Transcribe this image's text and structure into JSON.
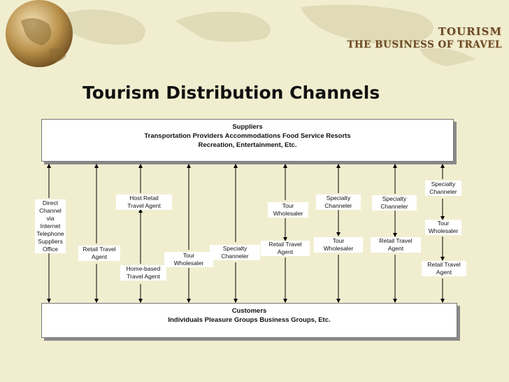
{
  "brand": {
    "line1": "TOURISM",
    "line2": "THE BUSINESS OF TRAVEL"
  },
  "title": "Tourism Distribution Channels",
  "suppliers": {
    "heading": "Suppliers",
    "line1": "Transportation Providers Accommodations Food Service Resorts",
    "line2": "Recreation, Entertainment, Etc."
  },
  "customers": {
    "heading": "Customers",
    "line1": "Individuals Pleasure Groups Business Groups, Etc."
  },
  "channels": {
    "direct": [
      "Direct",
      "Channel",
      "via",
      "Internet",
      "Telephone",
      "Suppliers",
      "Office"
    ],
    "retail_agent_1": [
      "Retail Travel",
      "Agent"
    ],
    "host_retail": [
      "Host Retail",
      "Travel Agent"
    ],
    "home_based": [
      "Home-based",
      "Travel Agent"
    ],
    "tour_wholesaler_1": [
      "Tour",
      "Wholesaler"
    ],
    "specialty_1": [
      "Specialty",
      "Channeler"
    ],
    "tour_wholesaler_2": [
      "Tour",
      "Wholesaler"
    ],
    "retail_agent_2": [
      "Retail Travel",
      "Agent"
    ],
    "specialty_2": [
      "Specialty",
      "Channeler"
    ],
    "tour_wholesaler_3": [
      "Tour",
      "Wholesaler"
    ],
    "specialty_3": [
      "Specialty",
      "Channeler"
    ],
    "retail_agent_3": [
      "Retail Travel",
      "Agent"
    ],
    "specialty_4": [
      "Specialty",
      "Channeler"
    ],
    "tour_wholesaler_4": [
      "Tour",
      "Wholesaler"
    ],
    "retail_agent_4": [
      "Retail Travel",
      "Agent"
    ]
  },
  "colors": {
    "background": "#f1eed0",
    "brand": "#6b4a26",
    "arrow": "#000000"
  }
}
